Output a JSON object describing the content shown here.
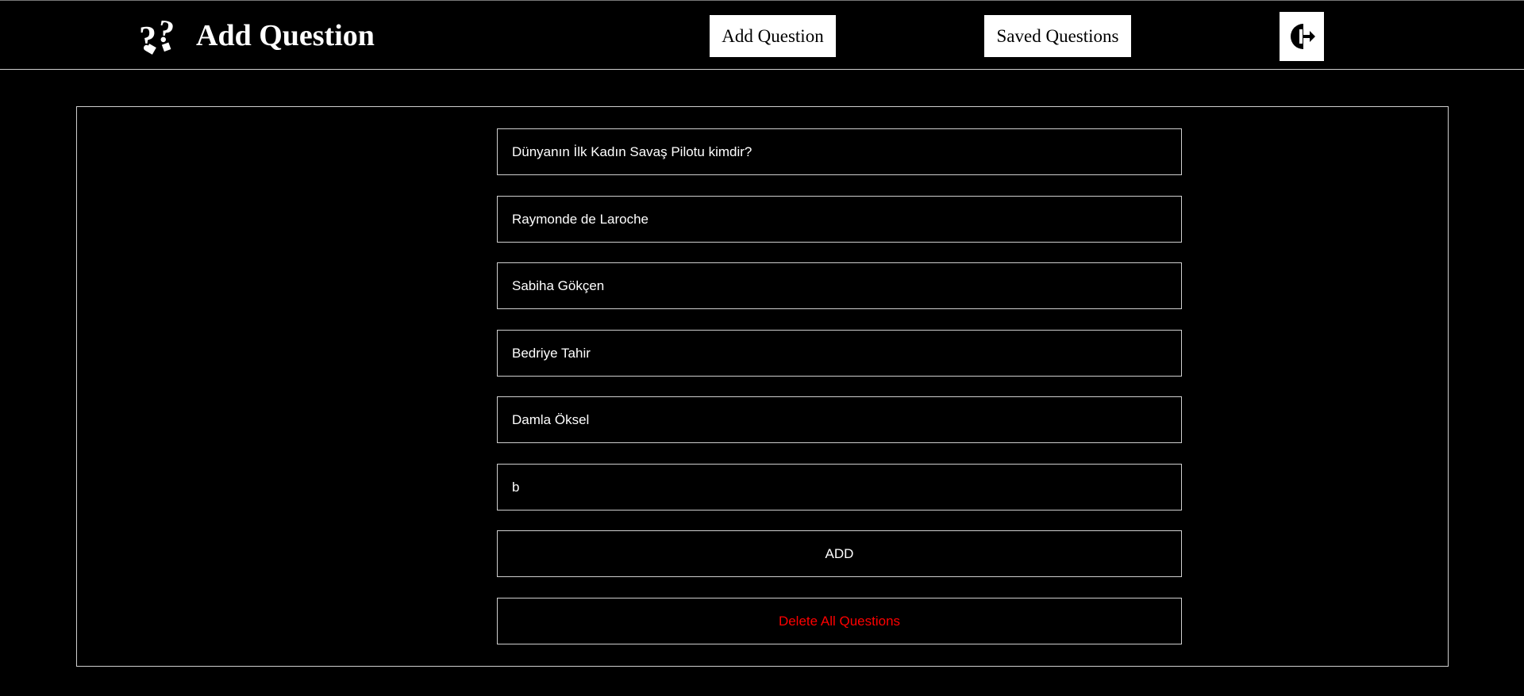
{
  "header": {
    "icon": "question-marks-icon",
    "title": "Add Question",
    "nav": {
      "add_question_label": "Add Question",
      "saved_questions_label": "Saved Questions",
      "logout_icon": "logout-door-icon"
    }
  },
  "form": {
    "question_value": "Dünyanın İlk Kadın Savaş Pilotu kimdir?",
    "option_1_value": "Raymonde de Laroche",
    "option_2_value": "Sabiha Gökçen",
    "option_3_value": "Bedriye Tahir",
    "option_4_value": "Damla Öksel",
    "answer_value": "b",
    "add_label": "ADD",
    "delete_all_label": "Delete All Questions"
  },
  "colors": {
    "background": "#000000",
    "foreground": "#ffffff",
    "danger": "#ff0000",
    "border": "#cfcfcf"
  }
}
